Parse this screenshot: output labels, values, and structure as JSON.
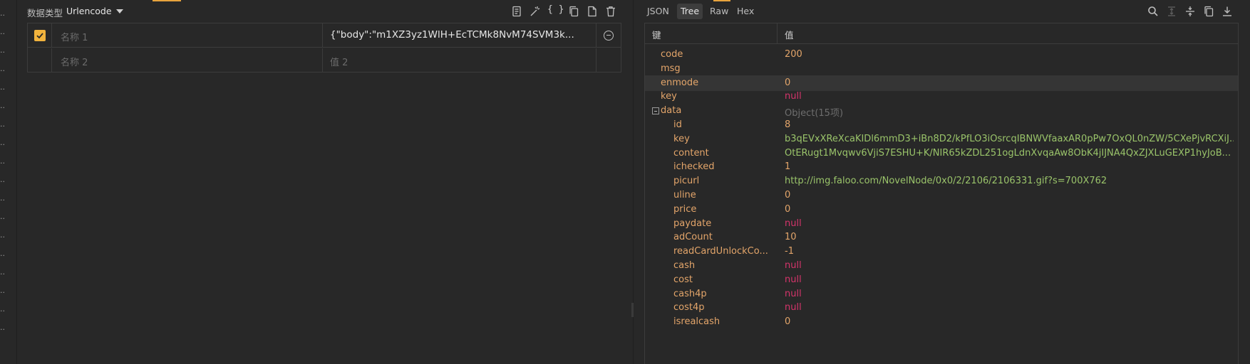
{
  "left_pane": {
    "data_type_label": "数据类型",
    "data_type_value": "Urlencode",
    "icons": [
      "document-icon",
      "magic-wand-icon",
      "braces-icon",
      "copy-icon",
      "file-icon",
      "trash-icon"
    ],
    "braces_text": "{ }",
    "rows": [
      {
        "checked": true,
        "name_placeholder": "名称 1",
        "value": "{\"body\":\"m1XZ3yz1WlH+EcTCMk8NvM74SVM3k..."
      },
      {
        "checked": false,
        "name_placeholder": "名称 2",
        "value_placeholder": "值 2"
      }
    ]
  },
  "right_pane": {
    "tabs": [
      {
        "label": "JSON",
        "active": false
      },
      {
        "label": "Tree",
        "active": true
      },
      {
        "label": "Raw",
        "active": false
      },
      {
        "label": "Hex",
        "active": false
      }
    ],
    "icons": [
      "search-icon",
      "expand-icon",
      "collapse-icon",
      "copy-icon",
      "download-icon"
    ],
    "header": {
      "key": "键",
      "value": "值"
    },
    "tree": [
      {
        "key": "code",
        "value": "200",
        "kind": "num",
        "depth": 0
      },
      {
        "key": "msg",
        "value": "",
        "kind": "str",
        "depth": 0
      },
      {
        "key": "enmode",
        "value": "0",
        "kind": "num",
        "depth": 0,
        "highlight": true
      },
      {
        "key": "key",
        "value": "null",
        "kind": "null",
        "depth": 0
      },
      {
        "key": "data",
        "value": "Object(15项)",
        "kind": "meta",
        "depth": 0,
        "expandable": true
      },
      {
        "key": "id",
        "value": "8",
        "kind": "num",
        "depth": 1
      },
      {
        "key": "key",
        "value": "b3qEVxXReXcaKIDl6mmD3+iBn8D2/kPfLO3iOsrcqIBNWVfaaxAR0pPw7OxQL0nZW/5CXePjvRCXiJ...",
        "kind": "str",
        "depth": 1
      },
      {
        "key": "content",
        "value": "OtERugt1Mvqwv6VjiS7ESHU+K/NIR65kZDL251ogLdnXvqaAw8ObK4jIJNA4QxZJXLuGEXP1hyJoB...",
        "kind": "str",
        "depth": 1
      },
      {
        "key": "ichecked",
        "value": "1",
        "kind": "num",
        "depth": 1
      },
      {
        "key": "picurl",
        "value": "http://img.faloo.com/NovelNode/0x0/2/2106/2106331.gif?s=700X762",
        "kind": "str",
        "depth": 1
      },
      {
        "key": "uline",
        "value": "0",
        "kind": "num",
        "depth": 1
      },
      {
        "key": "price",
        "value": "0",
        "kind": "num",
        "depth": 1
      },
      {
        "key": "paydate",
        "value": "null",
        "kind": "null",
        "depth": 1
      },
      {
        "key": "adCount",
        "value": "10",
        "kind": "num",
        "depth": 1
      },
      {
        "key": "readCardUnlockCo...",
        "value": "-1",
        "kind": "num",
        "depth": 1
      },
      {
        "key": "cash",
        "value": "null",
        "kind": "null",
        "depth": 1
      },
      {
        "key": "cost",
        "value": "null",
        "kind": "null",
        "depth": 1
      },
      {
        "key": "cash4p",
        "value": "null",
        "kind": "null",
        "depth": 1
      },
      {
        "key": "cost4p",
        "value": "null",
        "kind": "null",
        "depth": 1
      },
      {
        "key": "isrealcash",
        "value": "0",
        "kind": "num",
        "depth": 1
      }
    ]
  },
  "colors": {
    "accent": "#e8a33d",
    "number": "#e3a56a",
    "null": "#d6346b",
    "string": "#9ac46a",
    "meta": "#6d6d6d"
  }
}
